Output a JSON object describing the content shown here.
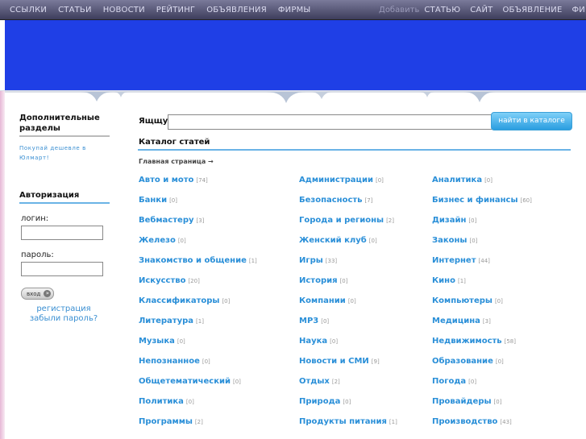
{
  "nav": {
    "left": [
      "ССЫЛКИ",
      "СТАТЬИ",
      "НОВОСТИ",
      "РЕЙТИНГ",
      "ОБЪЯВЛЕНИЯ",
      "ФИРМЫ"
    ],
    "add_label": "Добавить",
    "right": [
      "СТАТЬЮ",
      "САЙТ",
      "ОБЪЯВЛЕНИЕ",
      "ФИРМУ"
    ]
  },
  "colors": {
    "banner": "#1f3fe6",
    "link": "#2a8fd8",
    "accent_line": "#6ab3e6"
  },
  "sidebar": {
    "extra_title": "Дополнительные разделы",
    "extra_link": "Покупай дешевле в Юлмарт!",
    "auth_title": "Авторизация",
    "login_label": "логин:",
    "password_label": "пароль:",
    "login_button": "вход",
    "register_link": "регистрация",
    "forgot_link": "забыли пароль?"
  },
  "search": {
    "label": "Ящщу:",
    "button": "найти в каталоге"
  },
  "catalog": {
    "title": "Каталог статей",
    "breadcrumb": "Главная страница →",
    "columns": [
      [
        {
          "name": "Авто и мото",
          "count": "[74]"
        },
        {
          "name": "Банки",
          "count": "[0]"
        },
        {
          "name": "Вебмастеру",
          "count": "[3]"
        },
        {
          "name": "Железо",
          "count": "[0]"
        },
        {
          "name": "Знакомство и общение",
          "count": "[1]"
        },
        {
          "name": "Искусство",
          "count": "[20]"
        },
        {
          "name": "Классификаторы",
          "count": "[0]"
        },
        {
          "name": "Литература",
          "count": "[1]"
        },
        {
          "name": "Музыка",
          "count": "[0]"
        },
        {
          "name": "Непознанное",
          "count": "[0]"
        },
        {
          "name": "Общетематический",
          "count": "[0]"
        },
        {
          "name": "Политика",
          "count": "[0]"
        },
        {
          "name": "Программы",
          "count": "[2]"
        }
      ],
      [
        {
          "name": "Администрации",
          "count": "[0]"
        },
        {
          "name": "Безопасность",
          "count": "[7]"
        },
        {
          "name": "Города и регионы",
          "count": "[2]"
        },
        {
          "name": "Женский клуб",
          "count": "[0]"
        },
        {
          "name": "Игры",
          "count": "[33]"
        },
        {
          "name": "История",
          "count": "[0]"
        },
        {
          "name": "Компании",
          "count": "[0]"
        },
        {
          "name": "MP3",
          "count": "[0]"
        },
        {
          "name": "Наука",
          "count": "[0]"
        },
        {
          "name": "Новости и СМИ",
          "count": "[9]"
        },
        {
          "name": "Отдых",
          "count": "[2]"
        },
        {
          "name": "Природа",
          "count": "[0]"
        },
        {
          "name": "Продукты питания",
          "count": "[1]"
        }
      ],
      [
        {
          "name": "Аналитика",
          "count": "[0]"
        },
        {
          "name": "Бизнес и финансы",
          "count": "[60]"
        },
        {
          "name": "Дизайн",
          "count": "[0]"
        },
        {
          "name": "Законы",
          "count": "[0]"
        },
        {
          "name": "Интернет",
          "count": "[44]"
        },
        {
          "name": "Кино",
          "count": "[1]"
        },
        {
          "name": "Компьютеры",
          "count": "[0]"
        },
        {
          "name": "Медицина",
          "count": "[3]"
        },
        {
          "name": "Недвижимость",
          "count": "[58]"
        },
        {
          "name": "Образование",
          "count": "[0]"
        },
        {
          "name": "Погода",
          "count": "[0]"
        },
        {
          "name": "Провайдеры",
          "count": "[0]"
        },
        {
          "name": "Производство",
          "count": "[43]"
        }
      ]
    ]
  }
}
